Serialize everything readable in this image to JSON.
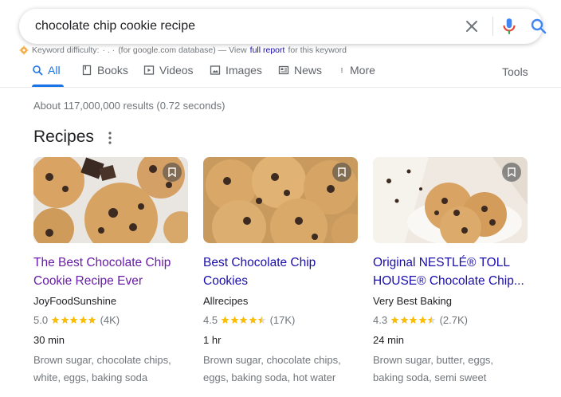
{
  "search": {
    "query": "chocolate chip cookie recipe"
  },
  "keyword_bar": {
    "label": "Keyword difficulty:",
    "value": "· . ·",
    "source": "(for google.com database) — View",
    "link": "full report",
    "suffix": "for this keyword"
  },
  "tabs": [
    {
      "label": "All",
      "icon": "search-icon",
      "active": true
    },
    {
      "label": "Books",
      "icon": "book-icon"
    },
    {
      "label": "Videos",
      "icon": "play-icon"
    },
    {
      "label": "Images",
      "icon": "image-icon"
    },
    {
      "label": "News",
      "icon": "news-icon"
    },
    {
      "label": "More",
      "icon": "more-vert-icon"
    }
  ],
  "tools_label": "Tools",
  "result_stats": "About 117,000,000 results (0.72 seconds)",
  "recipes": {
    "heading": "Recipes",
    "cards": [
      {
        "title_line1": "The Best Chocolate Chip",
        "title_line2": "Cookie Recipe Ever",
        "source": "JoyFoodSunshine",
        "rating": "5.0",
        "stars": 5,
        "reviews": "(4K)",
        "time": "30 min",
        "ingredients_line1": "Brown sugar, chocolate chips,",
        "ingredients_line2": "white, eggs, baking soda"
      },
      {
        "title_line1": "Best Chocolate Chip",
        "title_line2": "Cookies",
        "source": "Allrecipes",
        "rating": "4.5",
        "stars": 4.5,
        "reviews": "(17K)",
        "time": "1 hr",
        "ingredients_line1": "Brown sugar, chocolate chips,",
        "ingredients_line2": "eggs, baking soda, hot water"
      },
      {
        "title_line1": "Original NESTLÉ® TOLL",
        "title_line2": "HOUSE® Chocolate Chip...",
        "source": "Very Best Baking",
        "rating": "4.3",
        "stars": 4.5,
        "reviews": "(2.7K)",
        "time": "24 min",
        "ingredients_line1": "Brown sugar, butter, eggs,",
        "ingredients_line2": "baking soda, semi sweet"
      }
    ]
  },
  "colors": {
    "accent": "#1a73e8",
    "link": "#1a0dab",
    "visited": "#681da8",
    "star": "#fbbc04"
  }
}
